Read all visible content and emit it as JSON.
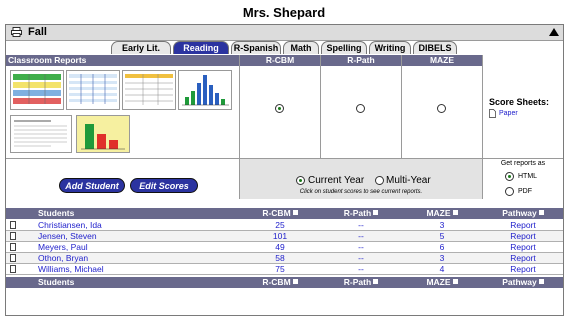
{
  "page_title": "Mrs. Shepard",
  "season": "Fall",
  "tabs": [
    {
      "label": "Early Lit.",
      "active": false
    },
    {
      "label": "Reading",
      "active": true
    },
    {
      "label": "R-Spanish",
      "active": false
    },
    {
      "label": "Math",
      "active": false
    },
    {
      "label": "Spelling",
      "active": false
    },
    {
      "label": "Writing",
      "active": false
    },
    {
      "label": "DIBELS",
      "active": false
    }
  ],
  "classroom_reports": {
    "header": "Classroom Reports",
    "measures": [
      "R-CBM",
      "R-Path",
      "MAZE"
    ],
    "selected_measure": "R-CBM",
    "score_sheets_label": "Score Sheets:",
    "score_sheets_link": "Paper"
  },
  "actions": {
    "add_student": "Add Student",
    "edit_scores": "Edit Scores"
  },
  "year_option": {
    "current": "Current Year",
    "multi": "Multi-Year",
    "selected": "Current Year",
    "hint": "Click on student scores to see current reports."
  },
  "report_format": {
    "label": "Get reports as",
    "options": [
      "HTML",
      "PDF"
    ],
    "selected": "HTML"
  },
  "table": {
    "columns": [
      "Students",
      "R-CBM",
      "R-Path",
      "MAZE",
      "Pathway"
    ],
    "rows": [
      {
        "name": "Christiansen, Ida",
        "rcbm": "25",
        "rpath": "--",
        "maze": "3",
        "pathway": "Report"
      },
      {
        "name": "Jensen, Steven",
        "rcbm": "101",
        "rpath": "--",
        "maze": "5",
        "pathway": "Report"
      },
      {
        "name": "Meyers, Paul",
        "rcbm": "49",
        "rpath": "--",
        "maze": "6",
        "pathway": "Report"
      },
      {
        "name": "Othon, Bryan",
        "rcbm": "58",
        "rpath": "--",
        "maze": "3",
        "pathway": "Report"
      },
      {
        "name": "Williams, Michael",
        "rcbm": "75",
        "rpath": "--",
        "maze": "4",
        "pathway": "Report"
      }
    ]
  },
  "colors": {
    "header_bg": "#69698c",
    "tab_active": "#2b33a0",
    "link": "#2222cc"
  }
}
